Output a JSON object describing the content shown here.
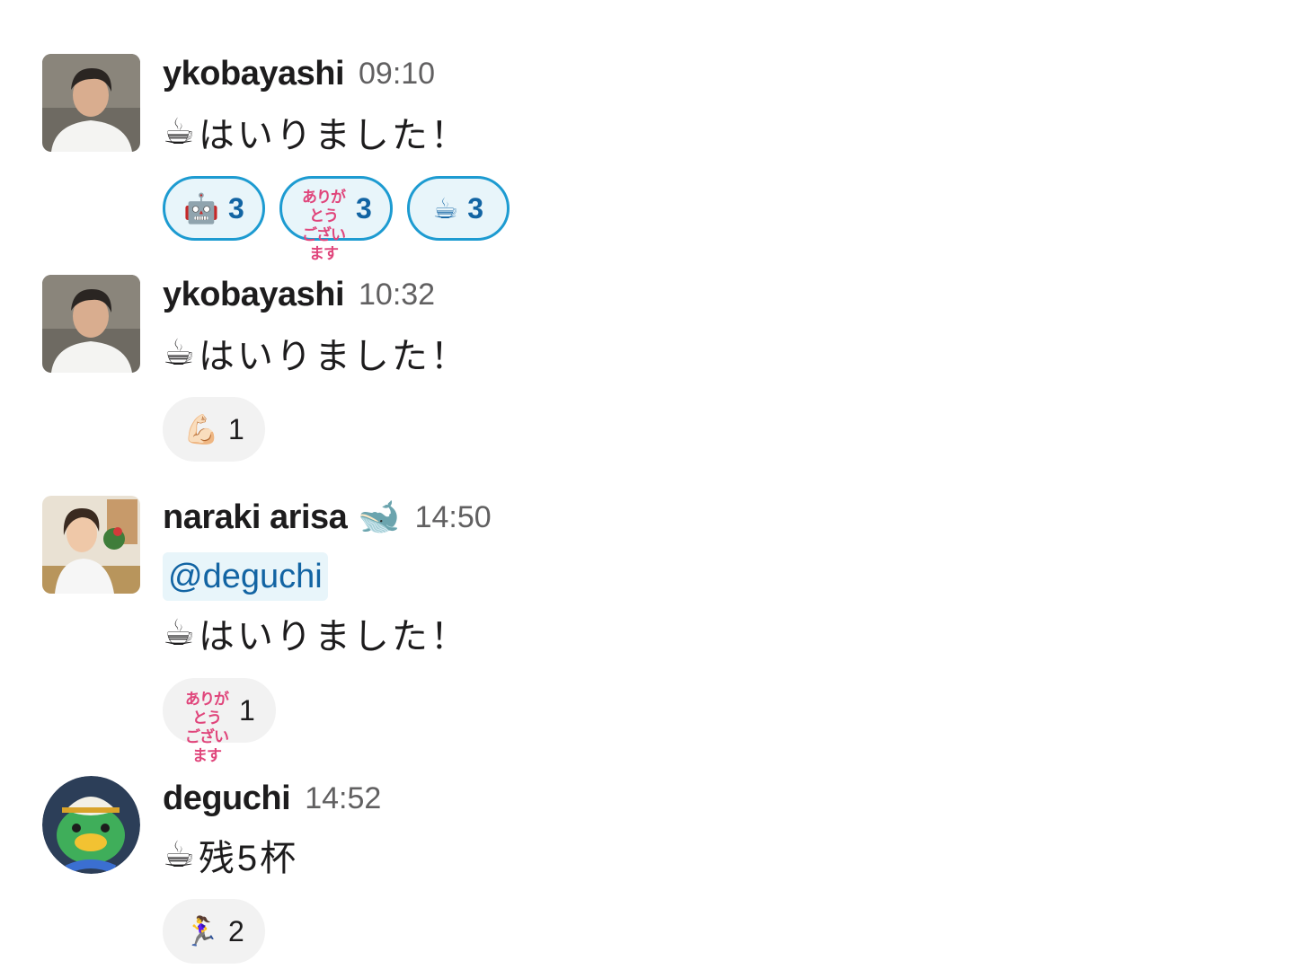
{
  "messages": [
    {
      "user": "ykobayashi",
      "status_emoji": "",
      "time": "09:10",
      "mention": "",
      "text_emoji": "☕",
      "text": "はいりました！",
      "avatar_icon": "person-photo",
      "reactions": [
        {
          "emoji": "🤖",
          "icon": "robot-face",
          "count": "3",
          "active": true
        },
        {
          "emoji": "",
          "icon": "arigatou-gozaimasu-custom",
          "label_top": "ありがとう",
          "label_bottom": "ございます",
          "count": "3",
          "active": true
        },
        {
          "emoji": "☕",
          "icon": "coffee",
          "count": "3",
          "active": true
        }
      ]
    },
    {
      "user": "ykobayashi",
      "status_emoji": "",
      "time": "10:32",
      "mention": "",
      "text_emoji": "☕",
      "text": "はいりました！",
      "avatar_icon": "person-photo",
      "reactions": [
        {
          "emoji": "💪🏻",
          "icon": "muscle",
          "count": "1",
          "active": false
        }
      ]
    },
    {
      "user": "naraki arisa",
      "status_emoji": "🐋",
      "time": "14:50",
      "mention": "@deguchi",
      "text_emoji": "☕",
      "text": "はいりました！",
      "avatar_icon": "person-photo",
      "reactions": [
        {
          "emoji": "",
          "icon": "arigatou-gozaimasu-custom",
          "label_top": "ありがとう",
          "label_bottom": "ございます",
          "count": "1",
          "active": false
        }
      ]
    },
    {
      "user": "deguchi",
      "status_emoji": "",
      "time": "14:52",
      "mention": "",
      "text_emoji": "☕",
      "text": " 残5杯",
      "avatar_icon": "kappa-character",
      "reactions": [
        {
          "emoji": "🏃‍♀️",
          "icon": "runner",
          "count": "2",
          "active": false
        }
      ]
    }
  ],
  "colors": {
    "reaction_active_bg": "#e8f5fa",
    "reaction_active_border": "#1d9bd1",
    "reaction_active_text": "#1264a3",
    "reaction_bg": "#f2f2f2",
    "mention_bg": "#e8f5fa",
    "mention_text": "#1264a3",
    "timestamp": "#616061",
    "arigatou_pink": "#e0457b"
  }
}
